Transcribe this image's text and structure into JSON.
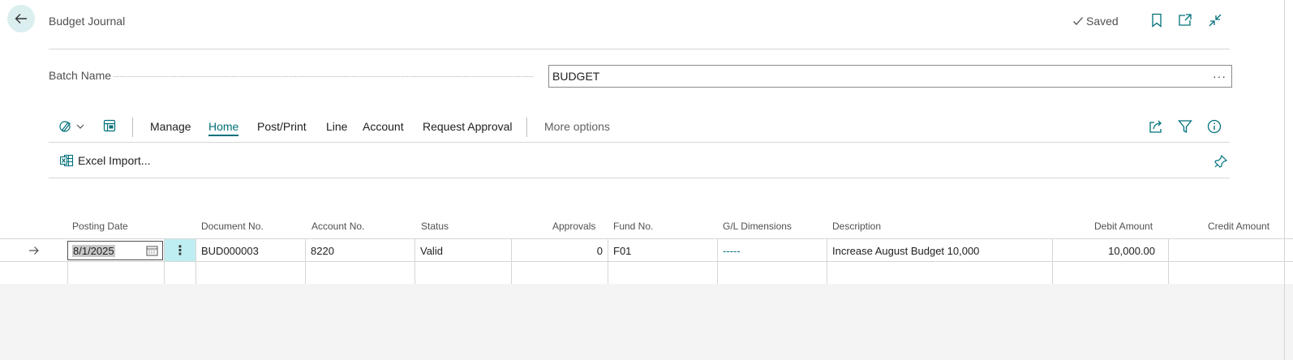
{
  "header": {
    "title": "Budget Journal",
    "saved_label": "Saved",
    "icons": [
      "back-arrow-icon",
      "checkmark-icon",
      "bookmark-icon",
      "open-new-window-icon",
      "collapse-icon"
    ]
  },
  "batch": {
    "label": "Batch Name",
    "value": "BUDGET",
    "lookup_label": "···"
  },
  "action_bar": {
    "menu": [
      "Manage",
      "Home",
      "Post/Print",
      "Line",
      "Account",
      "Request Approval"
    ],
    "active": "Home",
    "more_label": "More options"
  },
  "sub_actions": {
    "excel_import": "Excel Import..."
  },
  "grid": {
    "columns": [
      "Posting Date",
      "Document No.",
      "Account No.",
      "Status",
      "Approvals",
      "Fund No.",
      "G/L Dimensions",
      "Description",
      "Debit Amount",
      "Credit Amount"
    ],
    "rows": [
      {
        "posting_date": "8/1/2025",
        "document_no": "BUD000003",
        "account_no": "8220",
        "status": "Valid",
        "approvals": "0",
        "fund_no": "F01",
        "gl_dimensions": "-----",
        "description": "Increase August Budget 10,000",
        "debit_amount": "10,000.00",
        "credit_amount": ""
      }
    ],
    "row_menu_label": "⋮"
  },
  "colors": {
    "accent": "#00707a",
    "back_button_bg": "#dbeef0",
    "row_menu_bg": "#bfeef2",
    "grid_empty_bg": "#f4f4f4"
  }
}
